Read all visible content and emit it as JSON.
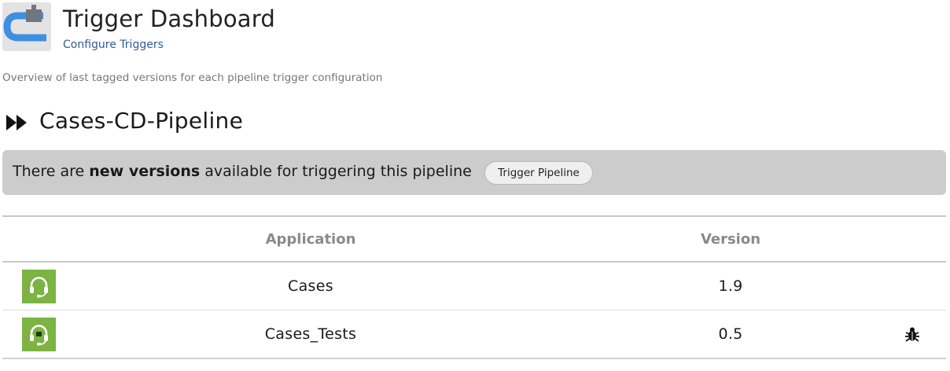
{
  "header": {
    "title": "Trigger Dashboard",
    "configure_link": "Configure Triggers",
    "icon": "pipeline-icon"
  },
  "overview": "Overview of last tagged versions for each pipeline trigger configuration",
  "pipeline": {
    "name": "Cases-CD-Pipeline",
    "icon": "fast-forward-icon",
    "notice": {
      "prefix": "There are ",
      "emphasis": "new versions",
      "suffix": " available for triggering this pipeline"
    },
    "trigger_button": "Trigger Pipeline"
  },
  "table": {
    "headers": {
      "application": "Application",
      "version": "Version"
    },
    "rows": [
      {
        "icon": "headset-icon",
        "application": "Cases",
        "version": "1.9",
        "extra_icon": ""
      },
      {
        "icon": "headset-icon",
        "application": "Cases_Tests",
        "version": "0.5",
        "extra_icon": "bug-icon"
      }
    ]
  },
  "colors": {
    "app_icon_green": "#7cb342",
    "notice_background": "#cccccc",
    "link": "#2e5e99"
  }
}
